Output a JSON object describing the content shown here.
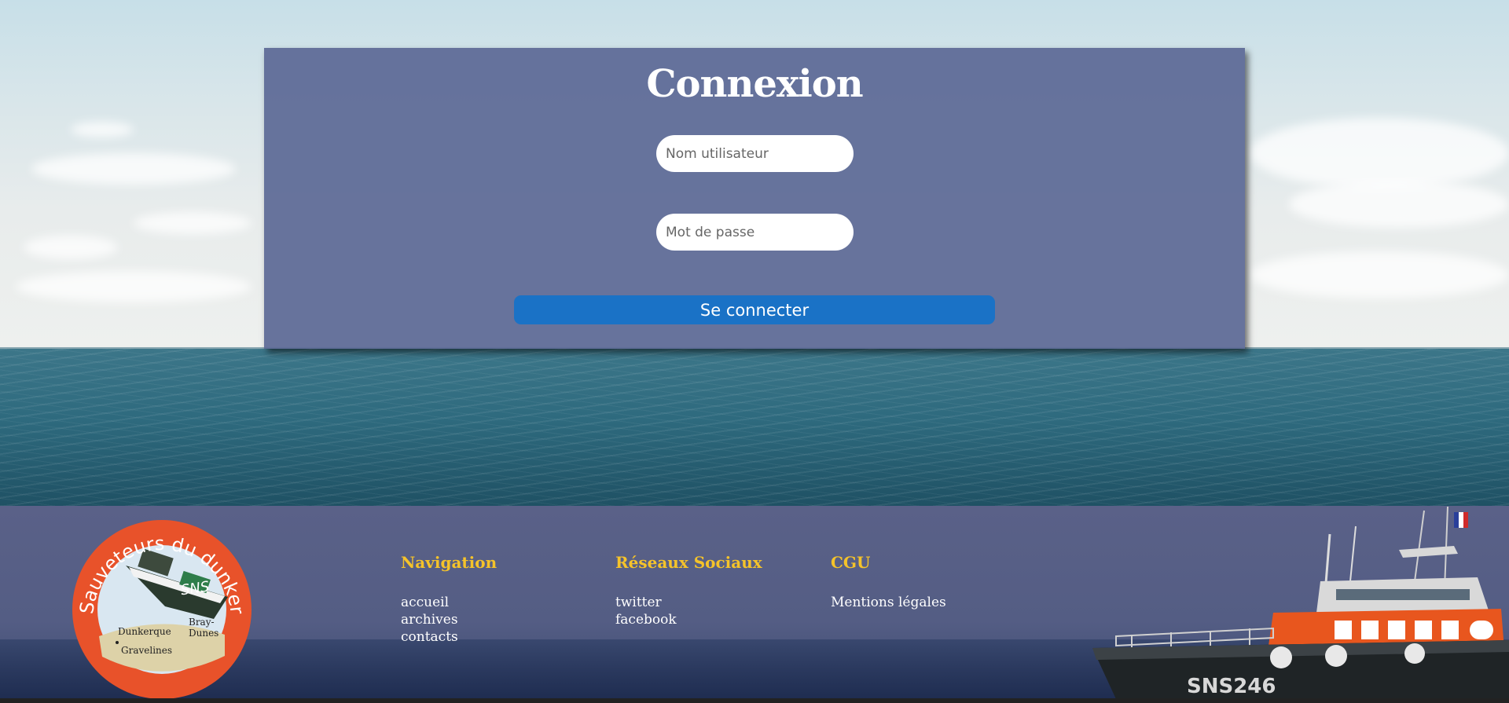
{
  "login": {
    "title": "Connexion",
    "username_placeholder": "Nom utilisateur",
    "username_value": "",
    "password_placeholder": "Mot de passe",
    "password_value": "",
    "submit_label": "Se connecter"
  },
  "footer": {
    "logo": {
      "ring_text": "Sauveteurs du dunkerquois",
      "badge_text": "SNS",
      "places": [
        "Dunkerque",
        "Bray-",
        "Dunes",
        "Gravelines"
      ]
    },
    "columns": [
      {
        "heading": "Navigation",
        "links": [
          "accueil",
          "archives",
          "contacts"
        ]
      },
      {
        "heading": "Réseaux Sociaux",
        "links": [
          "twitter",
          "facebook"
        ]
      },
      {
        "heading": "CGU",
        "links": [
          "Mentions légales"
        ]
      }
    ],
    "boat_label": "SNS246"
  },
  "colors": {
    "panel": "#5c6996",
    "button": "#1a72c6",
    "footer_heading": "#f5c32a",
    "footer_bg": "#575f86"
  }
}
